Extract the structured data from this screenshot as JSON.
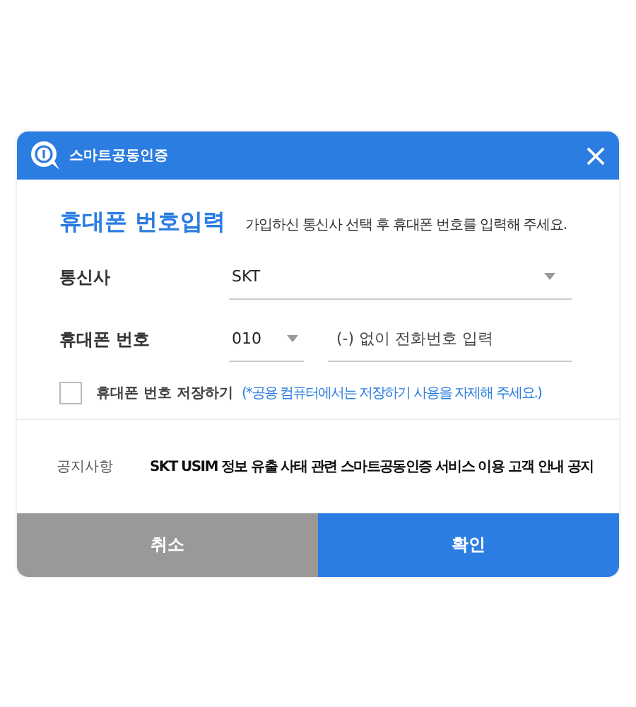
{
  "window": {
    "title": "스마트공동인증"
  },
  "heading": "휴대폰 번호입력",
  "instruction": "가입하신 통신사 선택 후 휴대폰 번호를 입력해 주세요.",
  "carrier": {
    "label": "통신사",
    "value": "SKT"
  },
  "phone": {
    "label": "휴대폰 번호",
    "prefix": "010",
    "placeholder": "(-) 없이 전화번호 입력"
  },
  "save": {
    "label": "휴대폰 번호 저장하기",
    "checked": false,
    "hint": "(*공용 컴퓨터에서는 저장하기 사용을 자제해 주세요.)"
  },
  "notice": {
    "label": "공지사항",
    "text": "SKT USIM 정보 유출 사태 관련 스마트공동인증 서비스 이용 고객 안내 공지"
  },
  "buttons": [
    {
      "label": "취소",
      "kind": "cancel"
    },
    {
      "label": "확인",
      "kind": "confirm"
    }
  ]
}
